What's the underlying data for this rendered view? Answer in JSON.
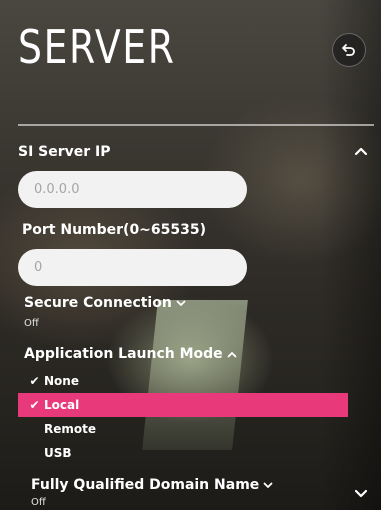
{
  "header": {
    "title": "SERVER",
    "back_icon": "back-arrow-icon"
  },
  "si_server_ip": {
    "label": "SI Server IP",
    "value": "",
    "placeholder": "0.0.0.0",
    "collapse_icon": "chevron-up-icon"
  },
  "port_number": {
    "label": "Port Number(0~65535)",
    "value": "",
    "placeholder": "0"
  },
  "secure_connection": {
    "label": "Secure Connection",
    "value": "Off",
    "icon": "chevron-down-icon"
  },
  "app_launch_mode": {
    "label": "Application Launch Mode",
    "icon": "chevron-up-icon",
    "options": [
      {
        "label": "None",
        "checked": true,
        "selected": false
      },
      {
        "label": "Local",
        "checked": true,
        "selected": true
      },
      {
        "label": "Remote",
        "checked": false,
        "selected": false
      },
      {
        "label": "USB",
        "checked": false,
        "selected": false
      }
    ]
  },
  "fqdn": {
    "label": "Fully Qualified Domain Name",
    "value": "Off",
    "icon": "chevron-down-icon"
  },
  "scroll": {
    "icon": "chevron-down-icon"
  },
  "colors": {
    "accent": "#e8397b",
    "input_background": "#f2f2f2",
    "text": "#ffffff"
  }
}
